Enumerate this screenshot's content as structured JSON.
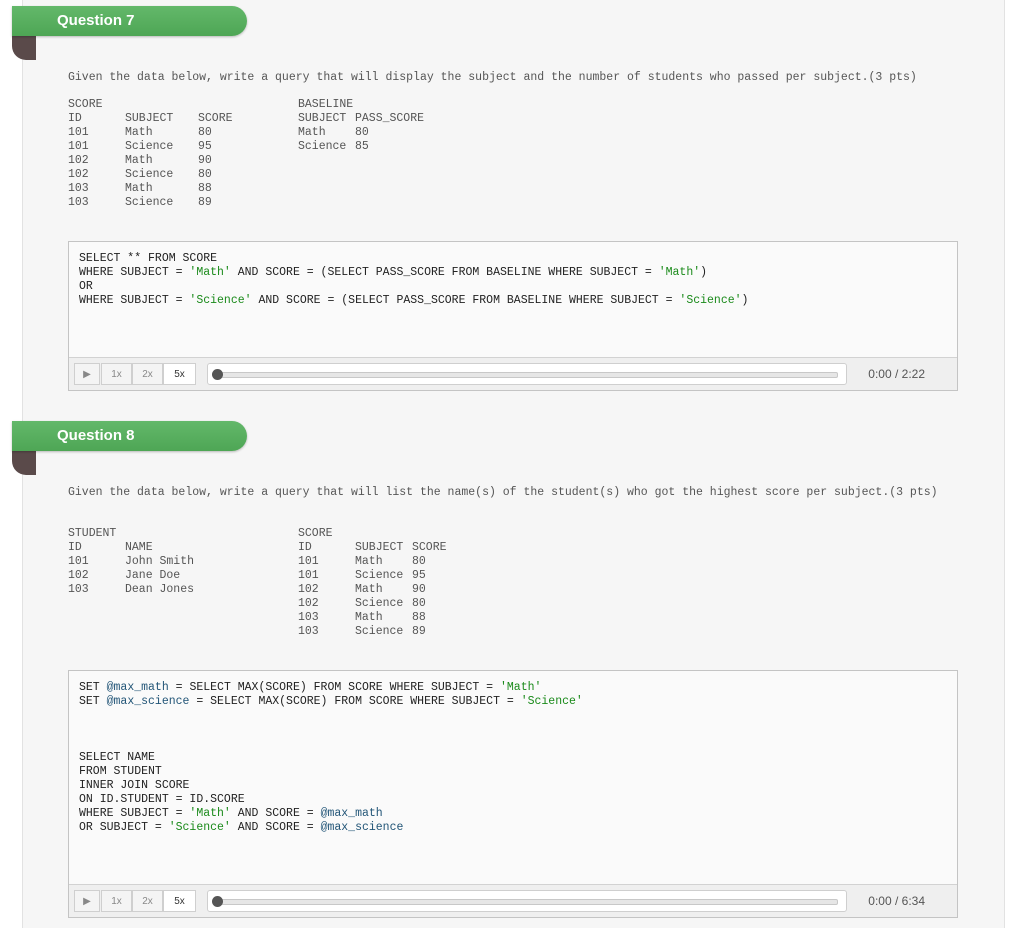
{
  "questions": [
    {
      "label": "Question 7",
      "prompt": "Given the data below, write a query that will display the subject and the number of students who passed per subject.(3 pts)",
      "left_table": {
        "title": "SCORE",
        "headers": [
          "ID",
          "SUBJECT",
          "SCORE"
        ],
        "rows": [
          [
            "101",
            "Math",
            "80"
          ],
          [
            "101",
            "Science",
            "95"
          ],
          [
            "102",
            "Math",
            "90"
          ],
          [
            "102",
            "Science",
            "80"
          ],
          [
            "103",
            "Math",
            "88"
          ],
          [
            "103",
            "Science",
            "89"
          ]
        ]
      },
      "right_table": {
        "title": "BASELINE",
        "headers": [
          "SUBJECT",
          "PASS_SCORE"
        ],
        "rows": [
          [
            "Math",
            "80"
          ],
          [
            "Science",
            "85"
          ]
        ]
      },
      "code_lines": [
        [
          {
            "t": "SELECT ** FROM SCORE"
          }
        ],
        [
          {
            "t": "WHERE SUBJECT = "
          },
          {
            "t": "'Math'",
            "k": "str"
          },
          {
            "t": " AND SCORE = (SELECT PASS_SCORE FROM BASELINE WHERE SUBJECT = "
          },
          {
            "t": "'Math'",
            "k": "str"
          },
          {
            "t": ")"
          }
        ],
        [
          {
            "t": "OR"
          }
        ],
        [
          {
            "t": "WHERE SUBJECT = "
          },
          {
            "t": "'Science'",
            "k": "str"
          },
          {
            "t": " AND SCORE = (SELECT PASS_SCORE FROM BASELINE WHERE SUBJECT = "
          },
          {
            "t": "'Science'",
            "k": "str"
          },
          {
            "t": ")"
          }
        ]
      ],
      "player": {
        "play_icon": "play-icon",
        "speeds": [
          "1x",
          "2x",
          "5x"
        ],
        "selected_speed": "5x",
        "progress": 0,
        "time": "0:00 / 2:22"
      }
    },
    {
      "label": "Question 8",
      "prompt": "Given the data below, write a query that will list the name(s) of the student(s) who got the highest score per subject.(3 pts)",
      "left_table": {
        "title": "STUDENT",
        "headers": [
          "ID",
          "NAME"
        ],
        "rows": [
          [
            "101",
            "John Smith"
          ],
          [
            "102",
            "Jane Doe"
          ],
          [
            "103",
            "Dean Jones"
          ]
        ]
      },
      "right_table": {
        "title": "SCORE",
        "headers": [
          "ID",
          "SUBJECT",
          "SCORE"
        ],
        "rows": [
          [
            "101",
            "Math",
            "80"
          ],
          [
            "101",
            "Science",
            "95"
          ],
          [
            "102",
            "Math",
            "90"
          ],
          [
            "102",
            "Science",
            "80"
          ],
          [
            "103",
            "Math",
            "88"
          ],
          [
            "103",
            "Science",
            "89"
          ]
        ]
      },
      "code_lines": [
        [
          {
            "t": "SET "
          },
          {
            "t": "@max_math",
            "k": "var"
          },
          {
            "t": " = SELECT MAX(SCORE) FROM SCORE WHERE SUBJECT = "
          },
          {
            "t": "'Math'",
            "k": "str"
          }
        ],
        [
          {
            "t": "SET "
          },
          {
            "t": "@max_science",
            "k": "var"
          },
          {
            "t": " = SELECT MAX(SCORE) FROM SCORE WHERE SUBJECT = "
          },
          {
            "t": "'Science'",
            "k": "str"
          }
        ],
        [],
        [],
        [],
        [
          {
            "t": "SELECT NAME"
          }
        ],
        [
          {
            "t": "FROM STUDENT"
          }
        ],
        [
          {
            "t": "INNER JOIN SCORE"
          }
        ],
        [
          {
            "t": "ON ID.STUDENT = ID.SCORE"
          }
        ],
        [
          {
            "t": "WHERE SUBJECT = "
          },
          {
            "t": "'Math'",
            "k": "str"
          },
          {
            "t": " AND SCORE = "
          },
          {
            "t": "@max_math",
            "k": "var"
          }
        ],
        [
          {
            "t": "OR SUBJECT = "
          },
          {
            "t": "'Science'",
            "k": "str"
          },
          {
            "t": " AND SCORE = "
          },
          {
            "t": "@max_science",
            "k": "var"
          }
        ]
      ],
      "player": {
        "play_icon": "play-icon",
        "speeds": [
          "1x",
          "2x",
          "5x"
        ],
        "selected_speed": "5x",
        "progress": 0,
        "time": "0:00 / 6:34"
      }
    }
  ],
  "colors": {
    "ribbon": "#4ea655",
    "string_literal": "#1a8a1a",
    "variable": "#225577"
  }
}
